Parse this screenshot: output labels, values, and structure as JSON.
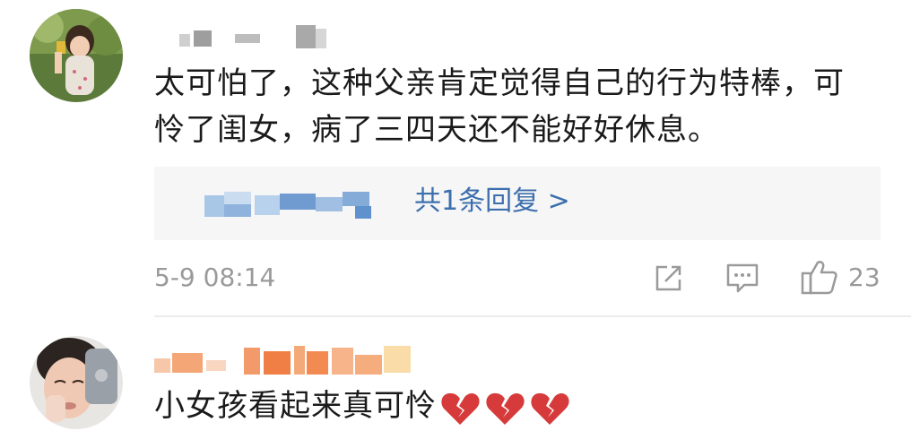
{
  "comments": [
    {
      "text_line1": "太可怕了，这种父亲肯定觉得自己的行为特棒，可",
      "text_line2": "怜了闺女，病了三四天还不能好好休息。",
      "reply_link": "共1条回复 >",
      "timestamp": "5-9 08:14",
      "like_count": "23",
      "icons": [
        "share-icon",
        "comment-icon",
        "thumbs-up-icon"
      ]
    },
    {
      "text": "小女孩看起来真可怜",
      "emoji": [
        "broken-heart",
        "broken-heart",
        "broken-heart"
      ]
    }
  ],
  "colors": {
    "link": "#3c6fae",
    "meta": "#9a9a9a",
    "text": "#1a1a1a",
    "reply_bg": "#f6f6f6",
    "heart": "#d63a3a"
  }
}
